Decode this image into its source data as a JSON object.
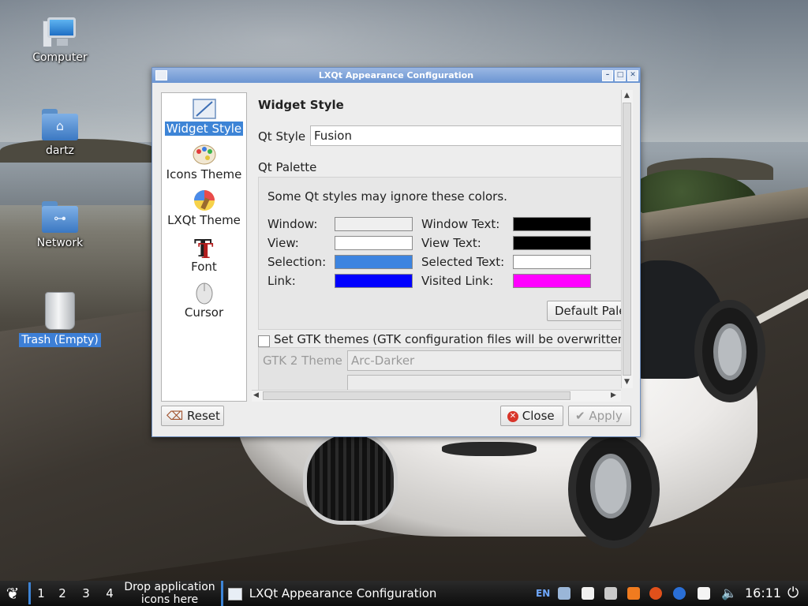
{
  "desktop": {
    "icons": [
      {
        "label": "Computer",
        "icon": "computer-icon"
      },
      {
        "label": "dartz",
        "icon": "home-folder-icon"
      },
      {
        "label": "Network",
        "icon": "network-folder-icon"
      },
      {
        "label": "Trash (Empty)",
        "icon": "trash-icon"
      }
    ]
  },
  "window": {
    "title": "LXQt Appearance Configuration",
    "controls": {
      "minimize": "–",
      "maximize": "□",
      "close": "✕"
    }
  },
  "sidebar": {
    "items": [
      {
        "label": "Widget Style",
        "icon": "widget-style-icon",
        "active": true
      },
      {
        "label": "Icons Theme",
        "icon": "icons-theme-icon"
      },
      {
        "label": "LXQt Theme",
        "icon": "lxqt-theme-icon"
      },
      {
        "label": "Font",
        "icon": "font-icon"
      },
      {
        "label": "Cursor",
        "icon": "cursor-icon"
      }
    ]
  },
  "content": {
    "heading": "Widget Style",
    "qt_style_label": "Qt Style",
    "qt_style_value": "Fusion",
    "qt_palette_label": "Qt Palette",
    "palette_note": "Some Qt styles may ignore these colors.",
    "colors": {
      "window_label": "Window:",
      "window_color": "#efefef",
      "window_text_label": "Window Text:",
      "window_text_color": "#000000",
      "view_label": "View:",
      "view_color": "#ffffff",
      "view_text_label": "View Text:",
      "view_text_color": "#000000",
      "selection_label": "Selection:",
      "selection_color": "#3d84e0",
      "selected_text_label": "Selected Text:",
      "selected_text_color": "#ffffff",
      "link_label": "Link:",
      "link_color": "#0000ff",
      "visited_link_label": "Visited Link:",
      "visited_link_color": "#ff00ff"
    },
    "default_palette_button": "Default Pale",
    "gtk_checkbox_label": "Set GTK themes (GTK configuration files will be overwritten",
    "gtk_checked": false,
    "gtk2_theme_label": "GTK 2 Theme",
    "gtk2_theme_value": "Arc-Darker"
  },
  "buttons": {
    "reset": "Reset",
    "close": "Close",
    "apply": "Apply"
  },
  "taskbar": {
    "workspaces": [
      "1",
      "2",
      "3",
      "4"
    ],
    "quicklaunch_hint_line1": "Drop application",
    "quicklaunch_hint_line2": "icons here",
    "task_title": "LXQt Appearance Configuration",
    "keyboard_layout": "EN",
    "clock": "16:11"
  }
}
